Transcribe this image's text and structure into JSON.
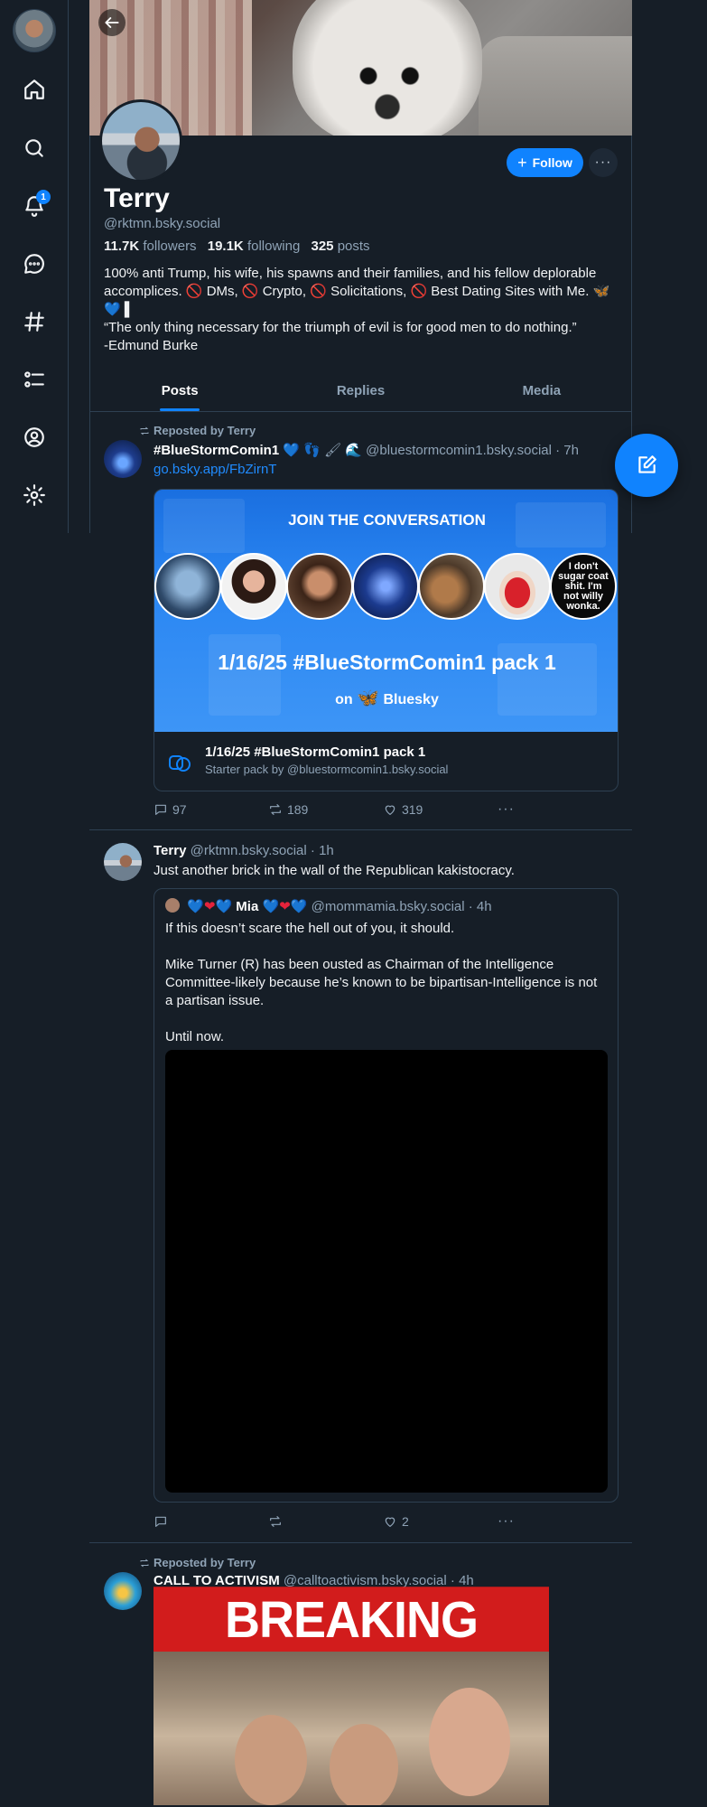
{
  "nav": {
    "notifications_badge": "1"
  },
  "profile": {
    "display_name": "Terry",
    "handle": "@rktmn.bsky.social",
    "followers_count": "11.7K",
    "followers_label": "followers",
    "following_count": "19.1K",
    "following_label": "following",
    "posts_count": "325",
    "posts_label": "posts",
    "bio": "100% anti Trump, his wife, his spawns and their families, and his fellow deplorable accomplices. 🚫 DMs, 🚫 Crypto, 🚫 Solicitations, 🚫 Best Dating Sites with Me. 🦋 💙 ▌\n“The only thing necessary for the triumph of evil is for good men to do nothing.”\n-Edmund Burke",
    "follow_label": "Follow",
    "more_label": "···"
  },
  "tabs": [
    {
      "label": "Posts",
      "active": true
    },
    {
      "label": "Replies",
      "active": false
    },
    {
      "label": "Media",
      "active": false
    }
  ],
  "posts": [
    {
      "repost_label": "Reposted by Terry",
      "author": "#BlueStormComin1",
      "author_emoji": "💙 👣 🖌 🌊",
      "handle_time": "@bluestormcomin1.bsky.social · 7h",
      "link": "go.bsky.app/FbZirnT",
      "card": {
        "headline": "JOIN THE CONVERSATION",
        "circle_text": "I don't sugar coat shit. I'm not willy wonka.",
        "title": "1/16/25 #BlueStormComin1 pack 1",
        "on_prefix": "on",
        "brand": "Bluesky",
        "name": "1/16/25 #BlueStormComin1 pack 1",
        "byline": "Starter pack by @bluestormcomin1.bsky.social"
      },
      "replies": "97",
      "reposts": "189",
      "likes": "319"
    },
    {
      "author": "Terry",
      "handle_time": "@rktmn.bsky.social · 1h",
      "text": "Just another brick in the wall of the Republican kakistocracy.",
      "quote": {
        "author": "Mia",
        "handle_time": "@mommamia.bsky.social · 4h",
        "text": "If this doesn’t scare the hell out of you, it should.\n\nMike Turner (R) has been ousted as Chairman of the Intelligence Committee-likely because he’s known to be bipartisan-Intelligence is not a partisan issue.\n\nUntil now."
      },
      "replies": "",
      "reposts": "",
      "likes": "2"
    },
    {
      "repost_label": "Reposted by Terry",
      "author": "CALL TO ACTIVISM",
      "handle_time": "@calltoactivism.bsky.social · 4h",
      "image_headline": "BREAKING NEWS"
    }
  ]
}
